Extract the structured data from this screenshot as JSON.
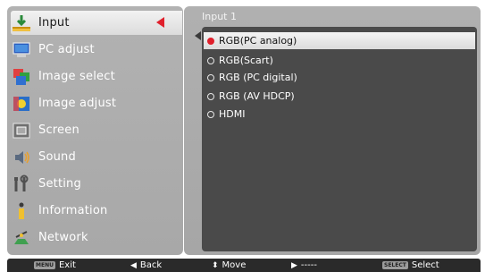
{
  "menu": {
    "items": [
      {
        "label": "Input",
        "icon": "input-icon"
      },
      {
        "label": "PC adjust",
        "icon": "pc-adjust-icon"
      },
      {
        "label": "Image select",
        "icon": "image-select-icon"
      },
      {
        "label": "Image adjust",
        "icon": "image-adjust-icon"
      },
      {
        "label": "Screen",
        "icon": "screen-icon"
      },
      {
        "label": "Sound",
        "icon": "sound-icon"
      },
      {
        "label": "Setting",
        "icon": "setting-icon"
      },
      {
        "label": "Information",
        "icon": "information-icon"
      },
      {
        "label": "Network",
        "icon": "network-icon"
      }
    ],
    "selected_index": 0
  },
  "submenu": {
    "title": "Input 1",
    "options": [
      {
        "label": "RGB(PC analog)"
      },
      {
        "label": "RGB(Scart)"
      },
      {
        "label": "RGB (PC digital)"
      },
      {
        "label": "RGB (AV HDCP)"
      },
      {
        "label": "HDMI"
      }
    ],
    "selected_index": 0
  },
  "footer": {
    "exit": {
      "key": "MENU",
      "label": "Exit"
    },
    "back": {
      "glyph": "◀",
      "label": "Back"
    },
    "move": {
      "glyph": "⬍",
      "label": "Move"
    },
    "next": {
      "glyph": "▶",
      "label": "-----"
    },
    "select": {
      "key": "SELECT",
      "label": "Select"
    }
  },
  "colors": {
    "accent_red": "#e0202c",
    "panel_gray": "#acacac",
    "list_dark": "#4a4a4a",
    "bar_dark": "#2a2a2a"
  }
}
